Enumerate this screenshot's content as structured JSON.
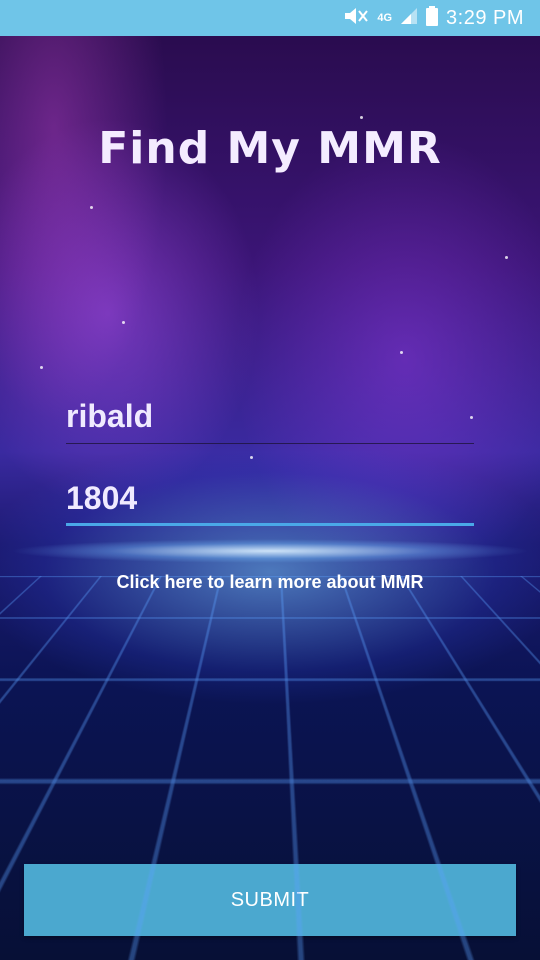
{
  "status_bar": {
    "time": "3:29 PM",
    "network": "4G",
    "icons": [
      "mute-icon",
      "network-4g-icon",
      "signal-icon",
      "battery-icon"
    ]
  },
  "title": "Find My MMR",
  "form": {
    "username": {
      "value": "ribald"
    },
    "mmr": {
      "value": "1804"
    }
  },
  "learn_more_link": "Click here to learn more about MMR",
  "submit_label": "SUBMIT",
  "colors": {
    "status_bar": "#6fc5e8",
    "submit_button": "#4ba8cf",
    "active_underline": "#4aa8e8"
  }
}
